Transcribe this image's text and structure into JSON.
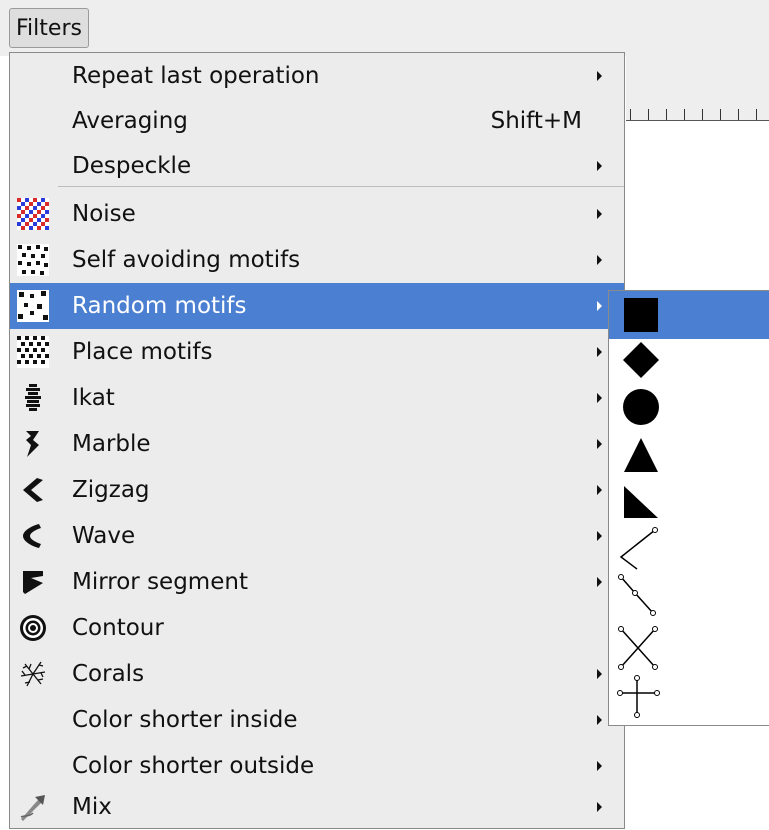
{
  "menubar": {
    "filters_label": "Filters"
  },
  "menu": {
    "items": [
      {
        "label": "Repeat last operation",
        "has_submenu": true,
        "icon": null
      },
      {
        "label": "Averaging",
        "shortcut": "Shift+M",
        "has_submenu": false,
        "icon": null
      },
      {
        "label": "Despeckle",
        "has_submenu": true,
        "icon": null
      },
      {
        "label": "Noise",
        "has_submenu": true,
        "icon": "noise-icon"
      },
      {
        "label": "Self avoiding motifs",
        "has_submenu": true,
        "icon": "self-avoiding-motifs-icon"
      },
      {
        "label": "Random motifs",
        "has_submenu": true,
        "icon": "random-motifs-icon",
        "highlighted": true
      },
      {
        "label": "Place motifs",
        "has_submenu": true,
        "icon": "place-motifs-icon"
      },
      {
        "label": "Ikat",
        "has_submenu": true,
        "icon": "ikat-icon"
      },
      {
        "label": "Marble",
        "has_submenu": true,
        "icon": "marble-icon"
      },
      {
        "label": "Zigzag",
        "has_submenu": true,
        "icon": "zigzag-icon"
      },
      {
        "label": "Wave",
        "has_submenu": true,
        "icon": "wave-icon"
      },
      {
        "label": "Mirror segment",
        "has_submenu": true,
        "icon": "mirror-segment-icon"
      },
      {
        "label": "Contour",
        "has_submenu": false,
        "icon": "contour-icon"
      },
      {
        "label": "Corals",
        "has_submenu": true,
        "icon": "corals-icon"
      },
      {
        "label": "Color shorter inside",
        "has_submenu": true,
        "icon": null
      },
      {
        "label": "Color shorter outside",
        "has_submenu": true,
        "icon": null
      },
      {
        "label": "Mix",
        "has_submenu": true,
        "icon": "mix-icon"
      }
    ]
  },
  "submenu": {
    "items": [
      {
        "icon": "square-icon",
        "highlighted": true
      },
      {
        "icon": "diamond-icon"
      },
      {
        "icon": "circle-icon"
      },
      {
        "icon": "triangle-icon"
      },
      {
        "icon": "right-triangle-icon"
      },
      {
        "icon": "angle-line-icon"
      },
      {
        "icon": "zigzag-line-icon"
      },
      {
        "icon": "cross-lines-icon"
      },
      {
        "icon": "plus-lines-icon"
      }
    ]
  },
  "colors": {
    "highlight": "#4a7fd1",
    "menu_bg": "#ececec"
  }
}
